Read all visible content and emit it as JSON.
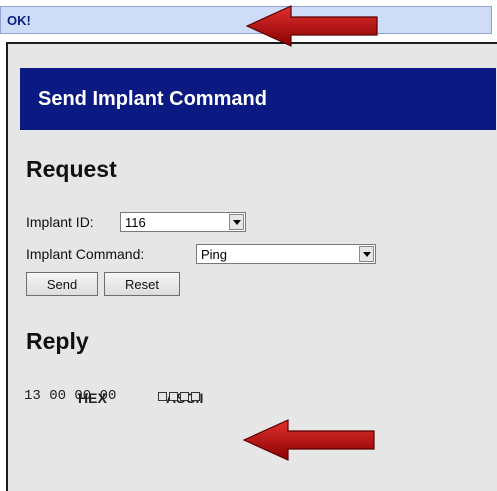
{
  "status": {
    "text": "OK!"
  },
  "panel": {
    "title": "Send Implant Command"
  },
  "request": {
    "heading": "Request",
    "implant_id_label": "Implant ID:",
    "implant_id_value": "116",
    "command_label": "Implant Command:",
    "command_value": "Ping",
    "send_label": "Send",
    "reset_label": "Reset"
  },
  "reply": {
    "heading": "Reply",
    "hex_header": "HEX",
    "ascii_header": "ASCII",
    "hex_value": "13 00 00 00"
  },
  "colors": {
    "header_bg": "#0b1a82",
    "arrow": "#c40000",
    "status_bg": "#cfdcf7"
  },
  "icons": [
    "dropdown-arrow-icon",
    "red-arrow-annotation"
  ]
}
